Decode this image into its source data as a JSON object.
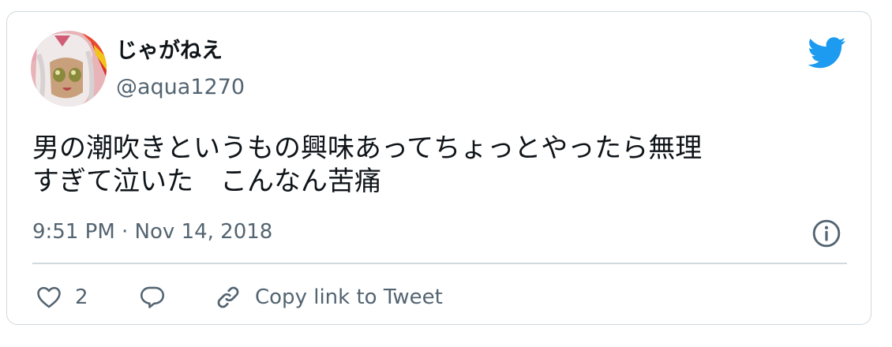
{
  "user": {
    "display_name": "じゃがねえ",
    "handle": "@aqua1270"
  },
  "tweet": {
    "text_lines": [
      "男の潮吹きというもの興味あってちょっとやったら無理",
      "すぎて泣いた　こんなん苦痛"
    ],
    "timestamp": "9:51 PM · Nov 14, 2018"
  },
  "actions": {
    "like_count": "2",
    "copy_link_label": "Copy link to Tweet"
  },
  "icons": {
    "brand": "twitter-bird-icon",
    "info": "info-icon",
    "like": "heart-icon",
    "reply": "reply-bubble-icon",
    "copy": "link-icon"
  },
  "colors": {
    "brand": "#1d9bf0",
    "text": "#0f1419",
    "secondary": "#536471",
    "border": "#cfd9de"
  }
}
